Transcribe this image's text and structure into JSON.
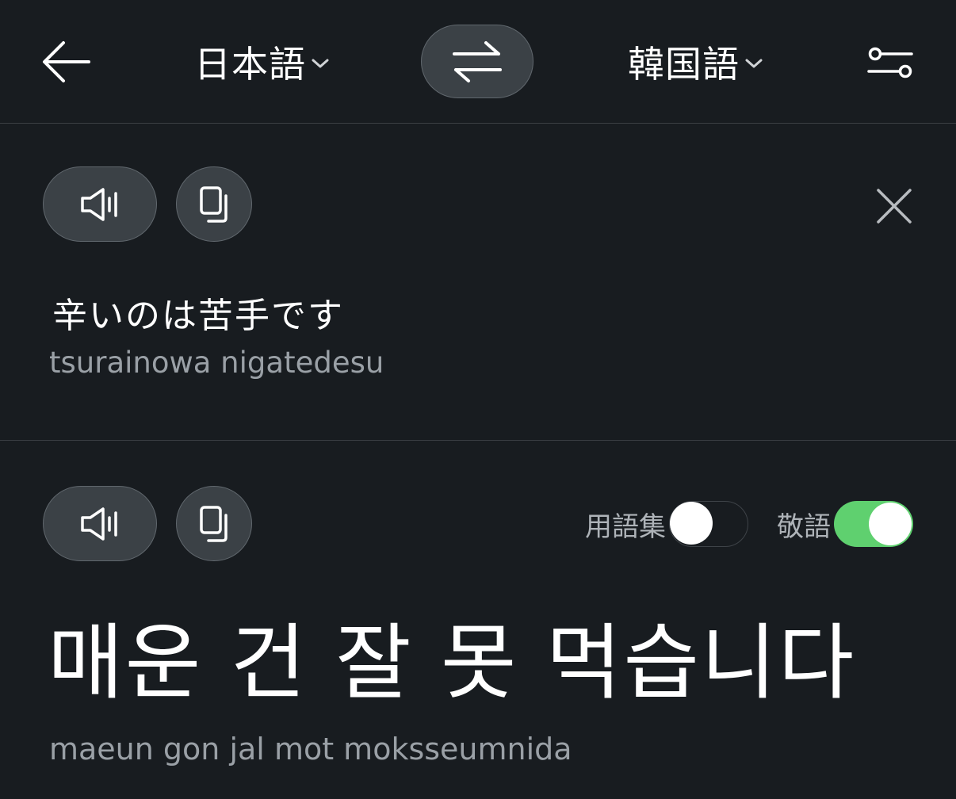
{
  "header": {
    "source_language": "日本語",
    "target_language": "韓国語",
    "icons": {
      "back": "arrow-left-icon",
      "swap": "swap-arrows-icon",
      "settings": "sliders-icon",
      "dropdown": "chevron-down-icon"
    }
  },
  "source": {
    "text": "辛いのは苦手です",
    "romanization": "tsurainowa nigatedesu",
    "icons": {
      "speak": "speaker-icon",
      "copy": "copy-icon",
      "clear": "close-icon"
    }
  },
  "target": {
    "text": "매운 건 잘 못 먹습니다",
    "romanization": "maeun gon jal mot moksseumnida",
    "glossary_label": "用語集",
    "glossary_enabled": false,
    "honorific_label": "敬語",
    "honorific_enabled": true,
    "icons": {
      "speak": "speaker-icon",
      "copy": "copy-icon"
    }
  },
  "colors": {
    "background": "#181c20",
    "button_fill": "#3b4146",
    "toggle_on": "#5fd06f",
    "secondary_text": "#9aa0a6"
  }
}
